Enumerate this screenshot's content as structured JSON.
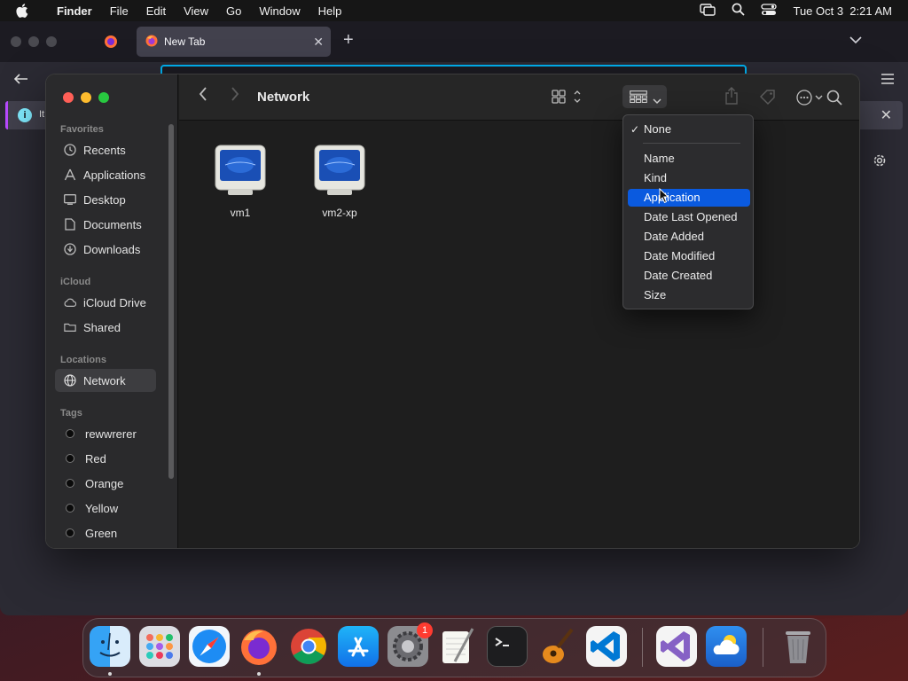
{
  "menubar": {
    "app_name": "Finder",
    "menus": [
      "File",
      "Edit",
      "View",
      "Go",
      "Window",
      "Help"
    ],
    "datetime": "Tue Oct 3  2:21 AM"
  },
  "browser": {
    "tab_title": "New Tab",
    "notice_text": "It"
  },
  "finder": {
    "title": "Network",
    "sidebar": {
      "favorites_heading": "Favorites",
      "favorites": [
        "Recents",
        "Applications",
        "Desktop",
        "Documents",
        "Downloads"
      ],
      "icloud_heading": "iCloud",
      "icloud": [
        "iCloud Drive",
        "Shared"
      ],
      "locations_heading": "Locations",
      "locations": [
        "Network"
      ],
      "tags_heading": "Tags",
      "tags": [
        "rewwrerer",
        "Red",
        "Orange",
        "Yellow",
        "Green"
      ]
    },
    "files": [
      "vm1",
      "vm2-xp"
    ]
  },
  "group_menu": {
    "items": [
      "None",
      "Name",
      "Kind",
      "Application",
      "Date Last Opened",
      "Date Added",
      "Date Modified",
      "Date Created",
      "Size"
    ],
    "checked": "None",
    "highlighted": "Application"
  },
  "dock": {
    "apps": [
      "finder",
      "launchpad",
      "safari",
      "firefox",
      "chrome",
      "app-store",
      "system-settings",
      "textedit",
      "terminal",
      "garageband",
      "vscode",
      "visual-studio",
      "weather",
      "trash"
    ],
    "badge_count": "1"
  },
  "colors": {
    "selection": "#0a5adf",
    "window_bg": "#1e1e1e",
    "sidebar_bg": "#2a2a2c"
  }
}
